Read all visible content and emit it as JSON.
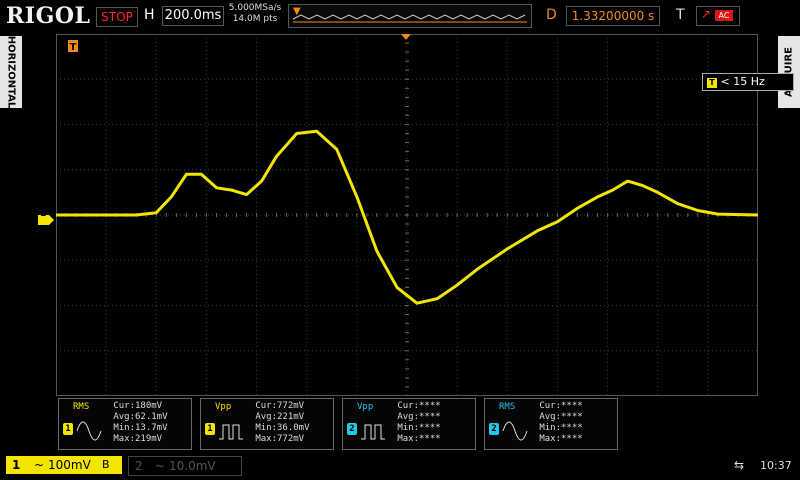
{
  "header": {
    "logo": "RIGOL",
    "run_status": "STOP",
    "horizontal_label": "H",
    "timebase": "200.0ms",
    "sample_rate": "5.000MSa/s",
    "memory_depth": "14.0M pts",
    "delay_label": "D",
    "delay_value": "1.33200000 s",
    "trigger_label": "T",
    "trigger_source_badge": "AC"
  },
  "side_tabs": {
    "left": "HORIZONTAL",
    "right": "ACQUIRE"
  },
  "display": {
    "frequency_readout": "< 15 Hz",
    "channel1_marker": "1",
    "trigger_position_marker": "T",
    "trace_color": "#f2e600",
    "grid_color": "#3a3a3a",
    "trigger_color": "#f08a1a",
    "waveform": {
      "baseline_div": 0,
      "samples": [
        [
          0,
          0
        ],
        [
          0.8,
          0
        ],
        [
          1.0,
          0.05
        ],
        [
          1.15,
          0.4
        ],
        [
          1.3,
          0.9
        ],
        [
          1.45,
          0.9
        ],
        [
          1.6,
          0.6
        ],
        [
          1.75,
          0.55
        ],
        [
          1.9,
          0.45
        ],
        [
          2.05,
          0.75
        ],
        [
          2.2,
          1.3
        ],
        [
          2.4,
          1.8
        ],
        [
          2.6,
          1.85
        ],
        [
          2.8,
          1.45
        ],
        [
          3.0,
          0.4
        ],
        [
          3.2,
          -0.8
        ],
        [
          3.4,
          -1.6
        ],
        [
          3.6,
          -1.95
        ],
        [
          3.8,
          -1.85
        ],
        [
          4.0,
          -1.55
        ],
        [
          4.2,
          -1.2
        ],
        [
          4.5,
          -0.75
        ],
        [
          4.8,
          -0.35
        ],
        [
          5.0,
          -0.15
        ],
        [
          5.2,
          0.15
        ],
        [
          5.4,
          0.4
        ],
        [
          5.55,
          0.55
        ],
        [
          5.7,
          0.75
        ],
        [
          5.85,
          0.65
        ],
        [
          6.0,
          0.5
        ],
        [
          6.2,
          0.25
        ],
        [
          6.4,
          0.1
        ],
        [
          6.6,
          0.02
        ],
        [
          7.0,
          0
        ]
      ]
    }
  },
  "measurements": [
    {
      "name": "RMS",
      "channel": "1",
      "color": "#f2e600",
      "shape": "sine",
      "cur": "180mV",
      "avg": "62.1mV",
      "min": "13.7mV",
      "max": "219mV"
    },
    {
      "name": "Vpp",
      "channel": "1",
      "color": "#f2e600",
      "shape": "pulse",
      "cur": "772mV",
      "avg": "221mV",
      "min": "36.0mV",
      "max": "772mV"
    },
    {
      "name": "Vpp",
      "channel": "2",
      "color": "#22c8e8",
      "shape": "pulse",
      "cur": "****",
      "avg": "****",
      "min": "****",
      "max": "****"
    },
    {
      "name": "RMS",
      "channel": "2",
      "color": "#22c8e8",
      "shape": "sine",
      "cur": "****",
      "avg": "****",
      "min": "****",
      "max": "****"
    }
  ],
  "measurement_labels": {
    "cur": "Cur:",
    "avg": "Avg:",
    "min": "Min:",
    "max": "Max:"
  },
  "footer": {
    "ch1_number": "1",
    "ch1_coupling": "~",
    "ch1_scale": "100mV",
    "ch1_bw": "B",
    "ch2_number": "2",
    "ch2_coupling": "~",
    "ch2_scale": "10.0mV",
    "usb_icon": "usb-icon",
    "time": "10:37"
  }
}
